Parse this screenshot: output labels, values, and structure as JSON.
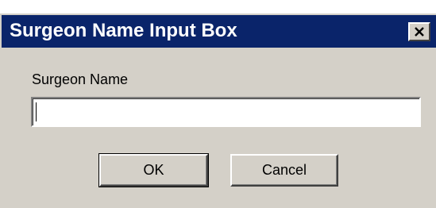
{
  "window": {
    "title": "Surgeon Name Input Box",
    "close_glyph": "✕",
    "close_icon": "close-icon",
    "colors": {
      "titlebar": "#0a246a",
      "face": "#d4d0c8",
      "title_text": "#ffffff"
    }
  },
  "form": {
    "label": "Surgeon Name",
    "input_value": "",
    "input_placeholder": ""
  },
  "buttons": {
    "ok_label": "OK",
    "cancel_label": "Cancel"
  }
}
